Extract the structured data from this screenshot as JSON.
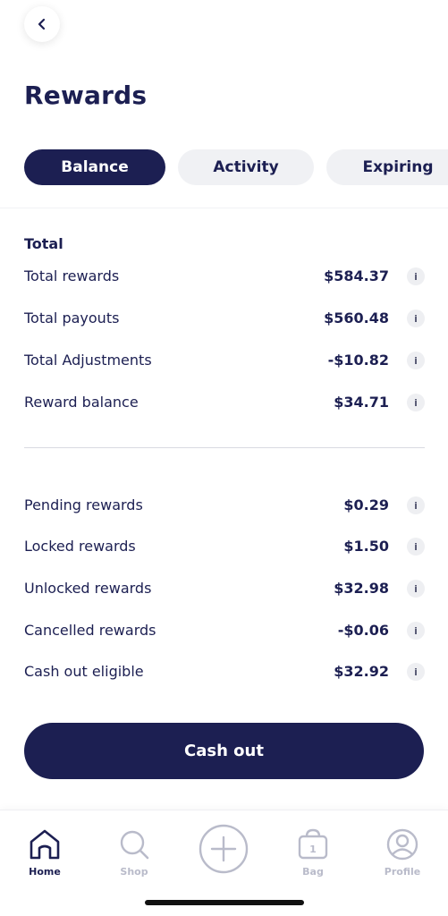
{
  "header": {
    "back_icon": "chevron-left-icon",
    "title": "Rewards"
  },
  "tabs": [
    {
      "label": "Balance",
      "active": true
    },
    {
      "label": "Activity",
      "active": false
    },
    {
      "label": "Expiring",
      "active": false
    }
  ],
  "totals": {
    "header": "Total",
    "rows": [
      {
        "label": "Total rewards",
        "value": "$584.37"
      },
      {
        "label": "Total payouts",
        "value": "$560.48"
      },
      {
        "label": "Total Adjustments",
        "value": "-$10.82"
      },
      {
        "label": "Reward balance",
        "value": "$34.71"
      }
    ]
  },
  "breakdown": {
    "rows": [
      {
        "label": "Pending rewards",
        "value": "$0.29"
      },
      {
        "label": "Locked rewards",
        "value": "$1.50"
      },
      {
        "label": "Unlocked rewards",
        "value": "$32.98"
      },
      {
        "label": "Cancelled rewards",
        "value": "-$0.06"
      },
      {
        "label": "Cash out eligible",
        "value": "$32.92"
      }
    ]
  },
  "info_icon_glyph": "i",
  "cash_out_label": "Cash out",
  "bottom_nav": [
    {
      "label": "Home",
      "icon": "home-icon",
      "active": true
    },
    {
      "label": "Shop",
      "icon": "search-icon",
      "active": false
    },
    {
      "label": "",
      "icon": "plus-circle-icon",
      "active": false
    },
    {
      "label": "Bag",
      "icon": "bag-icon",
      "active": false,
      "badge": "1"
    },
    {
      "label": "Profile",
      "icon": "profile-icon",
      "active": false
    }
  ],
  "colors": {
    "primary": "#1c1f52",
    "tab_inactive_bg": "#f0f1f4",
    "inactive_nav": "#b9bbca"
  }
}
